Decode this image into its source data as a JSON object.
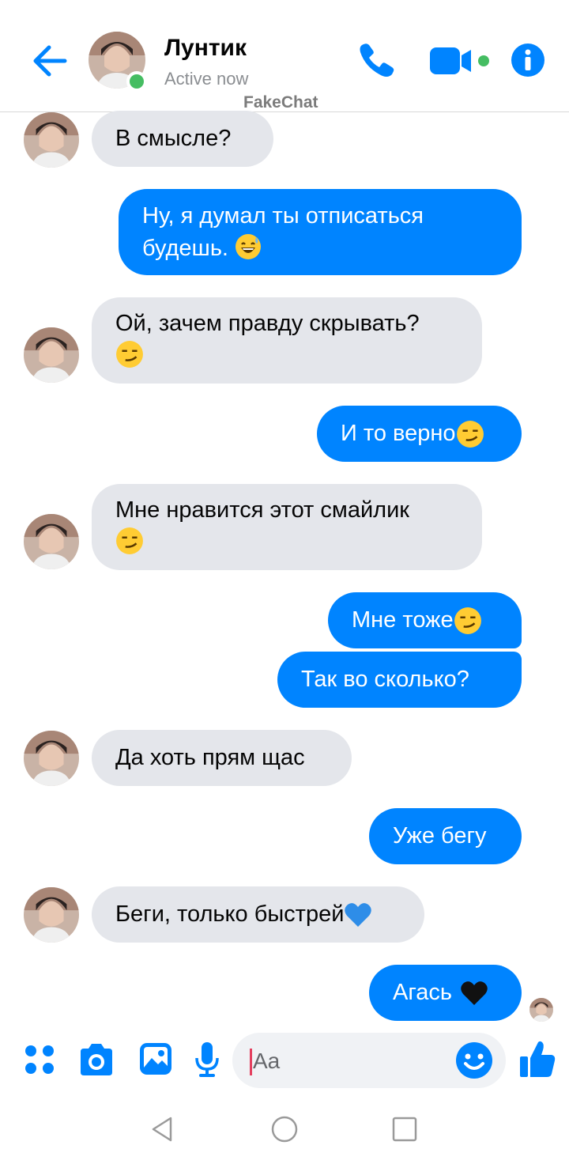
{
  "header": {
    "contact_name": "Лунтик",
    "status": "Active now",
    "watermark": "FakeChat"
  },
  "colors": {
    "accent": "#0084ff",
    "incoming_bubble": "#e4e6eb",
    "online": "#45bd62"
  },
  "icons": [
    "back-arrow-icon",
    "phone-icon",
    "video-camera-icon",
    "info-icon",
    "apps-grid-icon",
    "camera-icon",
    "image-icon",
    "microphone-icon",
    "smiley-icon",
    "thumbs-up-icon"
  ],
  "messages": [
    {
      "dir": "in",
      "text": "В смысле?"
    },
    {
      "dir": "out",
      "text": "Ну, я думал ты отписаться будешь. 😅",
      "lines": [
        "Ну, я думал ты отписаться",
        "будешь."
      ],
      "emoji": "grinning-sweat"
    },
    {
      "dir": "in",
      "text": "Ой, зачем правду скрывать? 😏",
      "lines": [
        "Ой, зачем правду скрывать?"
      ],
      "emoji": "smirk"
    },
    {
      "dir": "out",
      "text": "И то верно😏",
      "lines": [
        "И то верно"
      ],
      "emoji": "smirk"
    },
    {
      "dir": "in",
      "text": "Мне нравится этот смайлик 😏",
      "lines": [
        "Мне нравится этот смайлик"
      ],
      "emoji": "smirk"
    },
    {
      "dir": "out",
      "text": "Мне тоже😏",
      "lines": [
        "Мне тоже"
      ],
      "emoji": "smirk"
    },
    {
      "dir": "out",
      "text": "Так во сколько?"
    },
    {
      "dir": "in",
      "text": "Да хоть прям щас"
    },
    {
      "dir": "out",
      "text": "Уже бегу"
    },
    {
      "dir": "in",
      "text": "Беги, только быстрей💙",
      "lines": [
        "Беги, только быстрей"
      ],
      "emoji": "blue-heart"
    },
    {
      "dir": "out",
      "text": "Агась 🖤",
      "lines": [
        "Агась"
      ],
      "emoji": "black-heart"
    }
  ],
  "composer": {
    "placeholder": "Aa"
  }
}
